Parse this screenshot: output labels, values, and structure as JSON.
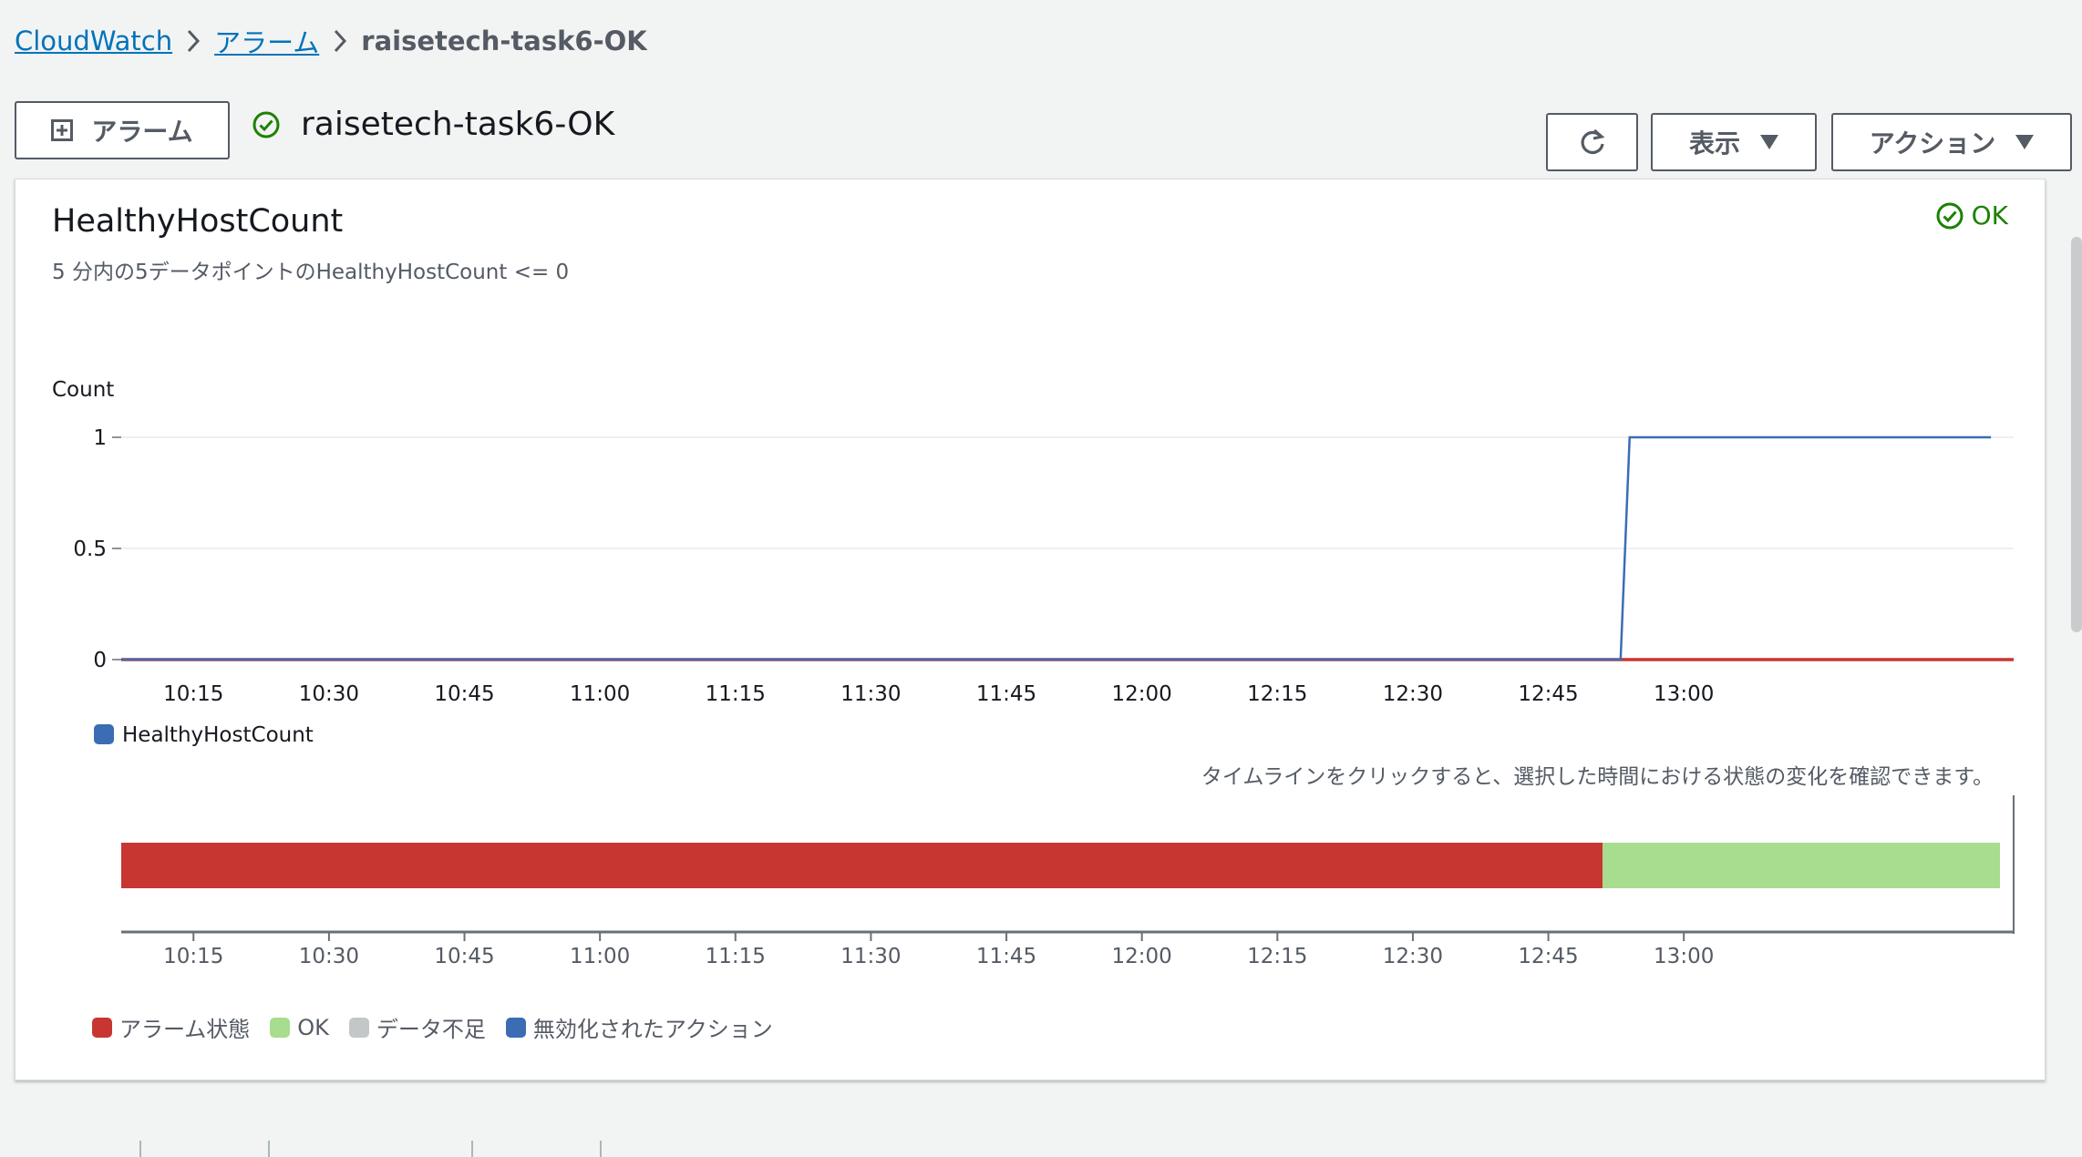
{
  "breadcrumb": {
    "items": [
      "CloudWatch",
      "アラーム"
    ],
    "current": "raisetech-task6-OK"
  },
  "header": {
    "add_alarm_label": "アラーム",
    "title": "raisetech-task6-OK",
    "display_label": "表示",
    "actions_label": "アクション"
  },
  "panel": {
    "metric_title": "HealthyHostCount",
    "description": "5 分内の5データポイントのHealthyHostCount <= 0",
    "status": "OK",
    "timeline_hint": "タイムラインをクリックすると、選択した時間における状態の変化を確認できます。"
  },
  "legend": {
    "alarm_state": "アラーム状態",
    "ok": "OK",
    "insufficient": "データ不足",
    "disabled_actions": "無効化されたアクション"
  },
  "colors": {
    "alarm": "#c83632",
    "ok": "#a8dc8e",
    "insufficient": "#c4c7c8",
    "disabled": "#3a6db4",
    "line": "#3a6db4",
    "threshold": "#c83632"
  },
  "chart_data": {
    "type": "line",
    "ylabel": "Count",
    "yticks": [
      "1",
      "0.5",
      "0"
    ],
    "ylim": [
      0,
      1
    ],
    "xlim": [
      "10:07",
      "13:35"
    ],
    "x_tick_labels": [
      "10:15",
      "10:30",
      "10:45",
      "11:00",
      "11:15",
      "11:30",
      "11:45",
      "12:00",
      "12:15",
      "12:30",
      "12:45",
      "13:00"
    ],
    "series": [
      {
        "name": "HealthyHostCount",
        "color": "#3a6db4",
        "x": [
          "10:07",
          "12:53",
          "12:54",
          "13:34"
        ],
        "values": [
          0,
          0,
          1,
          1
        ]
      }
    ],
    "threshold": 0,
    "timeline": [
      {
        "state": "alarm",
        "start": "10:07",
        "end": "12:51"
      },
      {
        "state": "ok",
        "start": "12:51",
        "end": "13:35"
      }
    ]
  }
}
